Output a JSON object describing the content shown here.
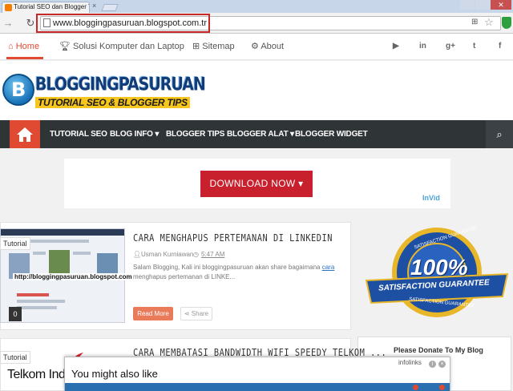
{
  "browser": {
    "tab_title": "Tutorial SEO dan Blogger Tip",
    "close_glyph": "×",
    "url": "www.bloggingpasuruan.blogspot.com.tr"
  },
  "topnav": {
    "items": [
      {
        "label": "Home",
        "icon": "home-icon"
      },
      {
        "label": "Solusi Komputer dan Laptop",
        "icon": "trophy-icon"
      },
      {
        "label": "Sitemap",
        "icon": "sitemap-icon"
      },
      {
        "label": "About",
        "icon": "gear-icon"
      }
    ],
    "social": [
      {
        "label": "▶",
        "icon": "youtube-icon"
      },
      {
        "label": "in",
        "icon": "linkedin-icon"
      },
      {
        "label": "g+",
        "icon": "googleplus-icon"
      },
      {
        "label": "t",
        "icon": "twitter-icon"
      },
      {
        "label": "f",
        "icon": "facebook-icon"
      }
    ]
  },
  "header": {
    "logo_title": "BLOGGINGPASURUAN",
    "logo_tagline": "TUTORIAL SEO & BLOGGER TIPS"
  },
  "menu": {
    "items": [
      {
        "label": "TUTORIAL SEO"
      },
      {
        "label": "BLOG INFO ▾"
      },
      {
        "label": "BLOGGER TIPS"
      },
      {
        "label": "BLOGGER ALAT ▾"
      },
      {
        "label": "BLOGGER WIDGET"
      }
    ]
  },
  "ad": {
    "button_label": "DOWNLOAD NOW",
    "brand": "InVid"
  },
  "posts": [
    {
      "tag": "Tutorial",
      "thumb_url": "http://bloggingpasuruan.blogspot.com",
      "comments": "0",
      "title": "CARA MENGHAPUS PERTEMANAN DI LINKEDIN",
      "author": "Usman Kurniawan",
      "time": "5:47 AM",
      "excerpt_before": "Salam Blogging, Kali ini bloggingpasuruan akan share bagaimana ",
      "excerpt_link": "cara",
      "excerpt_after": " menghapus pertemanan di LINKE...",
      "read_more": "Read More",
      "share": "Share"
    },
    {
      "tag": "Tutorial",
      "thumb_text": "Telkom Indones",
      "title": "CARA MEMBATASI BANDWIDTH WIFI SPEEDY TELKOM ..."
    }
  ],
  "sidebar": {
    "badge_big": "100%",
    "badge_ribbon": "SATISFACTION GUARANTEE",
    "badge_arc_top": "SATISFACTION GUARANTEE",
    "badge_arc_bottom": "SATISFACTION GUARANTEE",
    "donate_title": "Please Donate To My Blog"
  },
  "popup": {
    "title": "You might also like",
    "brand": "infolinks"
  },
  "colors": {
    "accent": "#e04a33",
    "menu_bg": "#2f3437",
    "download_red": "#c8202d",
    "badge_blue": "#1d4fa3",
    "badge_gold": "#e8b629"
  }
}
